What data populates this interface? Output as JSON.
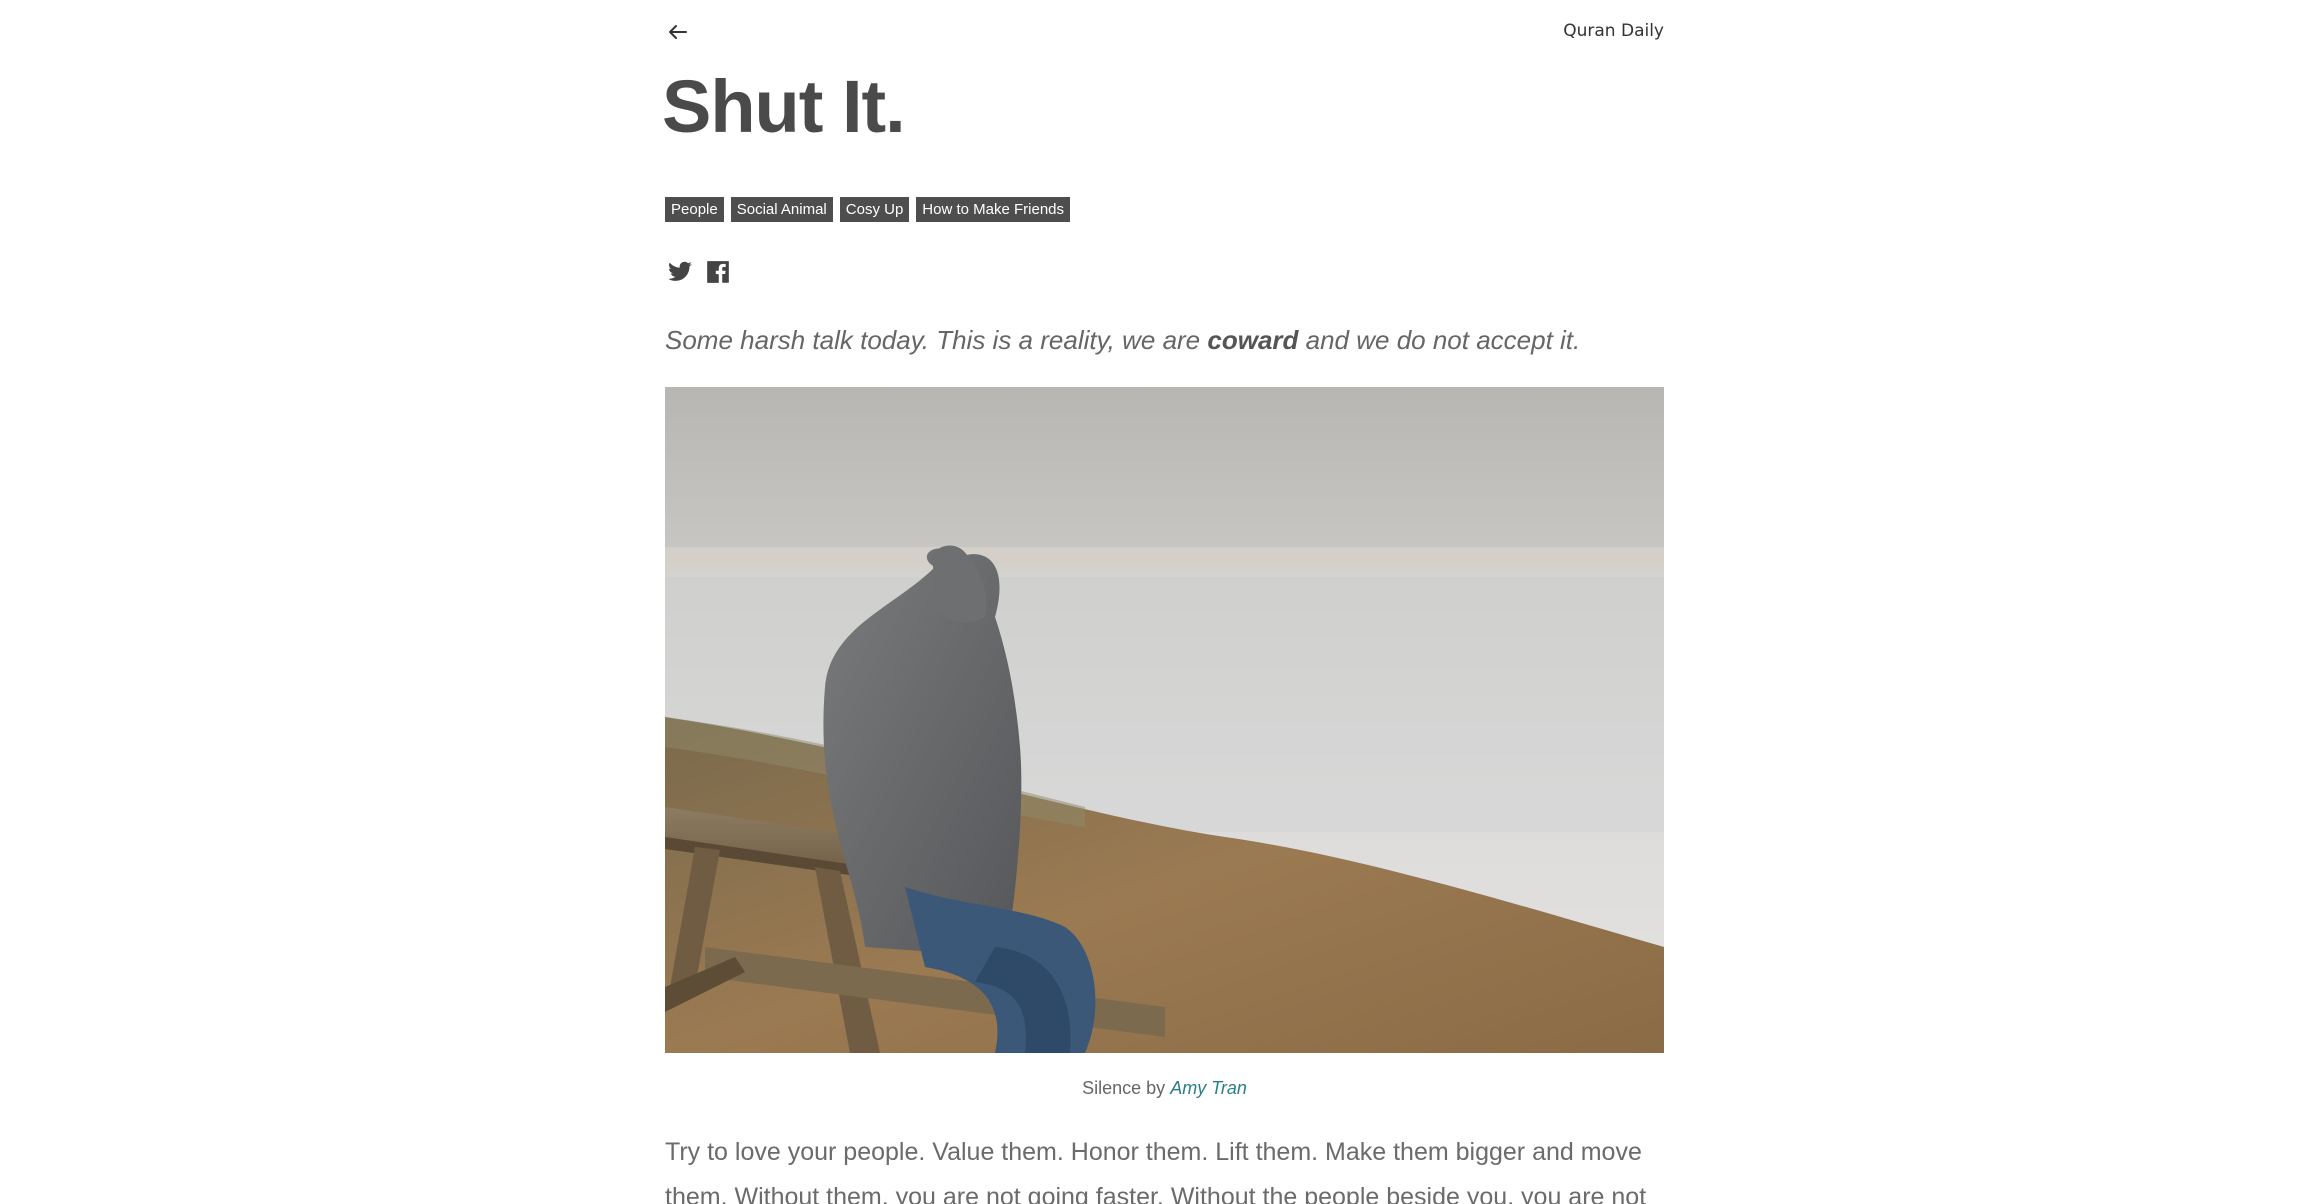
{
  "header": {
    "back_icon": "arrow-left-icon",
    "site_name": "Quran Daily"
  },
  "article": {
    "title": "Shut It.",
    "tags": [
      {
        "label": "People"
      },
      {
        "label": "Social Animal"
      },
      {
        "label": "Cosy Up"
      },
      {
        "label": "How to Make Friends"
      }
    ],
    "share": {
      "twitter_icon": "twitter-icon",
      "facebook_icon": "facebook-icon"
    },
    "lead": {
      "before": "Some harsh talk today. This is a reality, we are ",
      "emphasis": "coward",
      "after": " and we do not accept it."
    },
    "image": {
      "description": "photo-hooded-person-on-bench-by-foggy-lake"
    },
    "caption": {
      "text": "Silence by ",
      "author": "Amy Tran"
    },
    "body": "Try to love your people. Value them. Honor them. Lift them. Make them bigger and move them. Without them, you are not going faster. Without the people beside you, you are not"
  },
  "colors": {
    "tag_bg": "#4e4e4e",
    "tag_text": "#ffffff",
    "title": "#4a4a4a",
    "link": "#2a7f86"
  }
}
